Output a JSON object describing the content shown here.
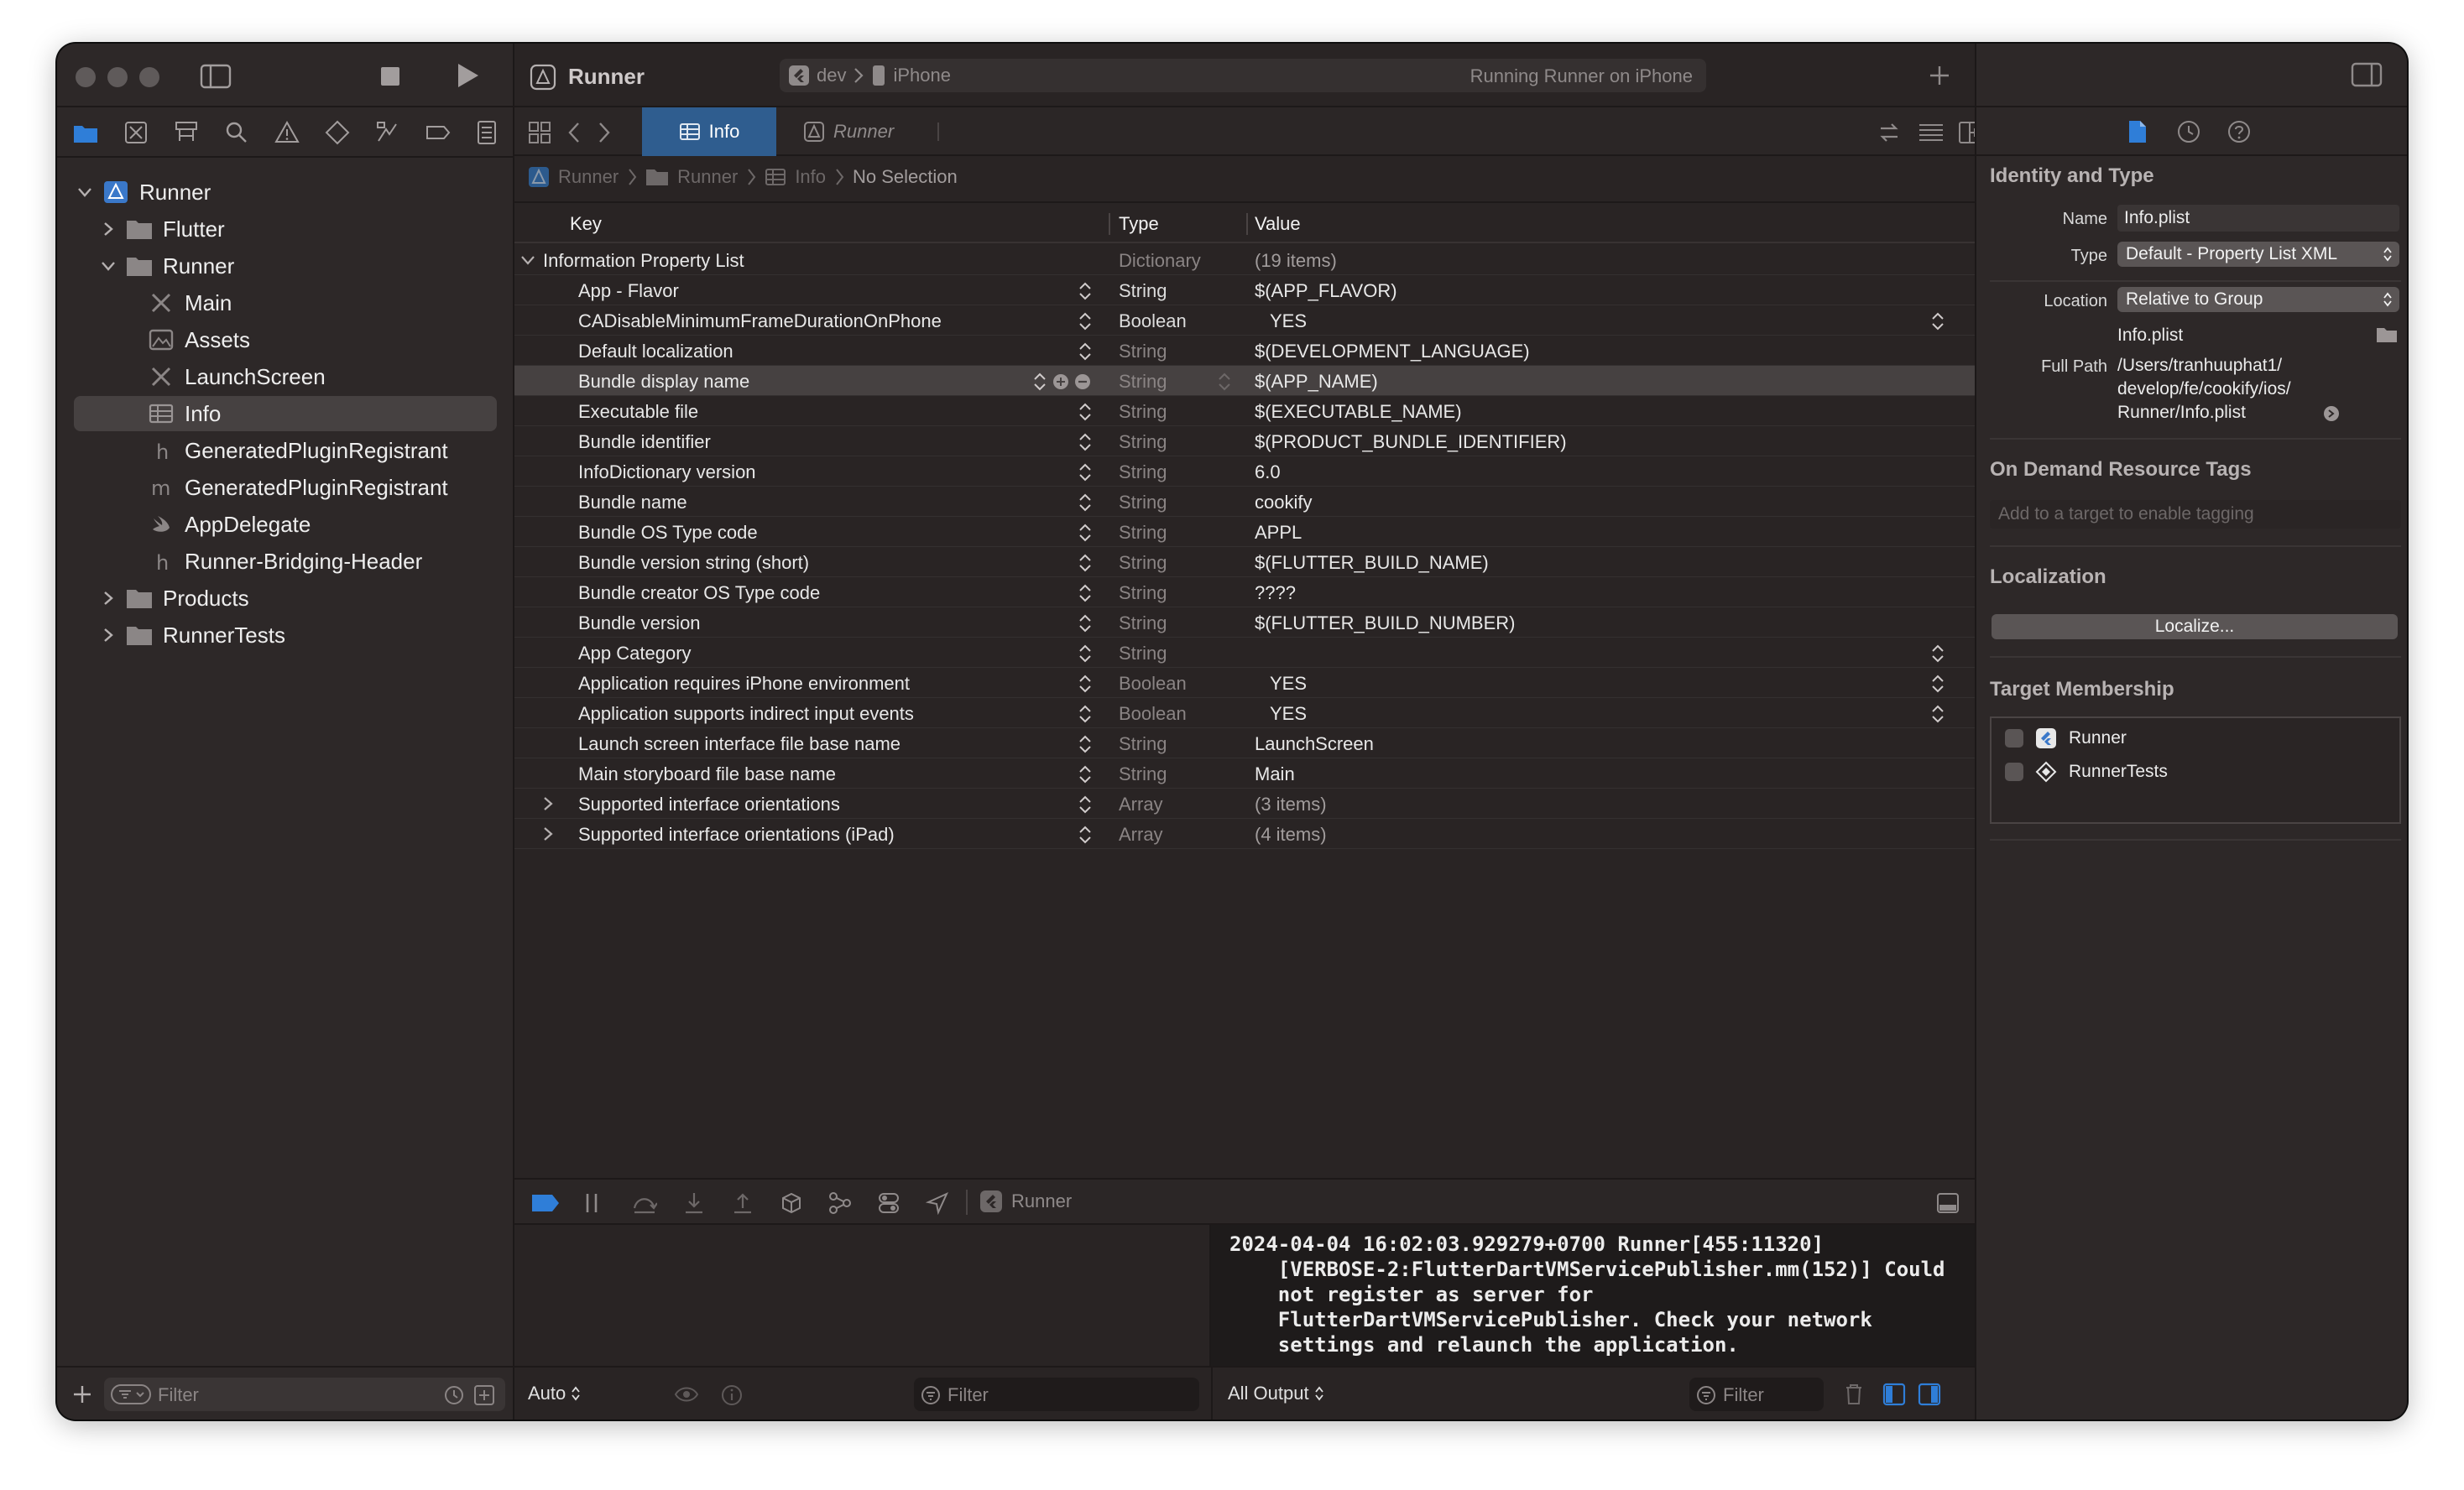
{
  "window": {
    "project_name": "Runner",
    "scheme": "dev",
    "device": "iPhone",
    "status": "Running Runner on iPhone"
  },
  "navigator": {
    "tree": [
      {
        "label": "Runner",
        "icon": "project-icon",
        "level": 0,
        "expanded": true
      },
      {
        "label": "Flutter",
        "icon": "folder-icon",
        "level": 1,
        "expanded": false
      },
      {
        "label": "Runner",
        "icon": "folder-icon",
        "level": 1,
        "expanded": true
      },
      {
        "label": "Main",
        "icon": "storyboard-icon",
        "level": 2
      },
      {
        "label": "Assets",
        "icon": "asset-catalog-icon",
        "level": 2
      },
      {
        "label": "LaunchScreen",
        "icon": "storyboard-icon",
        "level": 2
      },
      {
        "label": "Info",
        "icon": "plist-icon",
        "level": 2,
        "selected": true
      },
      {
        "label": "GeneratedPluginRegistrant",
        "icon": "header-file-icon",
        "level": 2
      },
      {
        "label": "GeneratedPluginRegistrant",
        "icon": "objc-file-icon",
        "level": 2
      },
      {
        "label": "AppDelegate",
        "icon": "swift-file-icon",
        "level": 2
      },
      {
        "label": "Runner-Bridging-Header",
        "icon": "header-file-icon",
        "level": 2
      },
      {
        "label": "Products",
        "icon": "folder-icon",
        "level": 1,
        "expanded": false
      },
      {
        "label": "RunnerTests",
        "icon": "folder-icon",
        "level": 1,
        "expanded": false
      }
    ],
    "filter_placeholder": "Filter"
  },
  "editor": {
    "tabs": [
      {
        "label": "Info",
        "active": true
      },
      {
        "label": "Runner",
        "active": false
      }
    ],
    "breadcrumb": [
      "Runner",
      "Runner",
      "Info",
      "No Selection"
    ],
    "columns": {
      "key": "Key",
      "type": "Type",
      "value": "Value"
    },
    "root": {
      "key": "Information Property List",
      "type": "Dictionary",
      "value": "(19 items)"
    },
    "rows": [
      {
        "key": "App - Flavor",
        "type": "String",
        "value": "$(APP_FLAVOR)"
      },
      {
        "key": "CADisableMinimumFrameDurationOnPhone",
        "type": "Boolean",
        "value": "YES"
      },
      {
        "key": "Default localization",
        "type": "String",
        "value": "$(DEVELOPMENT_LANGUAGE)"
      },
      {
        "key": "Bundle display name",
        "type": "String",
        "value": "$(APP_NAME)"
      },
      {
        "key": "Executable file",
        "type": "String",
        "value": "$(EXECUTABLE_NAME)"
      },
      {
        "key": "Bundle identifier",
        "type": "String",
        "value": "$(PRODUCT_BUNDLE_IDENTIFIER)"
      },
      {
        "key": "InfoDictionary version",
        "type": "String",
        "value": "6.0"
      },
      {
        "key": "Bundle name",
        "type": "String",
        "value": "cookify"
      },
      {
        "key": "Bundle OS Type code",
        "type": "String",
        "value": "APPL"
      },
      {
        "key": "Bundle version string (short)",
        "type": "String",
        "value": "$(FLUTTER_BUILD_NAME)"
      },
      {
        "key": "Bundle creator OS Type code",
        "type": "String",
        "value": "????"
      },
      {
        "key": "Bundle version",
        "type": "String",
        "value": "$(FLUTTER_BUILD_NUMBER)"
      },
      {
        "key": "App Category",
        "type": "String",
        "value": ""
      },
      {
        "key": "Application requires iPhone environment",
        "type": "Boolean",
        "value": "YES"
      },
      {
        "key": "Application supports indirect input events",
        "type": "Boolean",
        "value": "YES"
      },
      {
        "key": "Launch screen interface file base name",
        "type": "String",
        "value": "LaunchScreen"
      },
      {
        "key": "Main storyboard file base name",
        "type": "String",
        "value": "Main"
      },
      {
        "key": "Supported interface orientations",
        "type": "Array",
        "value": "(3 items)"
      },
      {
        "key": "Supported interface orientations (iPad)",
        "type": "Array",
        "value": "(4 items)"
      }
    ],
    "selected_row": "Bundle display name"
  },
  "debug": {
    "process": "Runner",
    "auto_label": "Auto",
    "filter_placeholder": "Filter",
    "output_label": "All Output",
    "console_filter_placeholder": "Filter",
    "console_text": "2024-04-04 16:02:03.929279+0700 Runner[455:11320]\n    [VERBOSE-2:FlutterDartVMServicePublisher.mm(152)] Could\n    not register as server for\n    FlutterDartVMServicePublisher. Check your network\n    settings and relaunch the application."
  },
  "inspector": {
    "identity_title": "Identity and Type",
    "name_label": "Name",
    "name_value": "Info.plist",
    "type_label": "Type",
    "type_value": "Default - Property List XML",
    "location_label": "Location",
    "location_value": "Relative to Group",
    "location_file": "Info.plist",
    "full_path_label": "Full Path",
    "full_path_lines": [
      "/Users/tranhuuphat1/",
      "develop/fe/cookify/ios/",
      "Runner/Info.plist"
    ],
    "odr_title": "On Demand Resource Tags",
    "odr_placeholder": "Add to a target to enable tagging",
    "localization_title": "Localization",
    "localize_button": "Localize...",
    "target_title": "Target Membership",
    "targets": [
      {
        "name": "Runner",
        "checked": false
      },
      {
        "name": "RunnerTests",
        "checked": false
      }
    ]
  },
  "colors": {
    "accent": "#2f7ed8",
    "window_bg": "#292424",
    "selection": "#464141"
  }
}
